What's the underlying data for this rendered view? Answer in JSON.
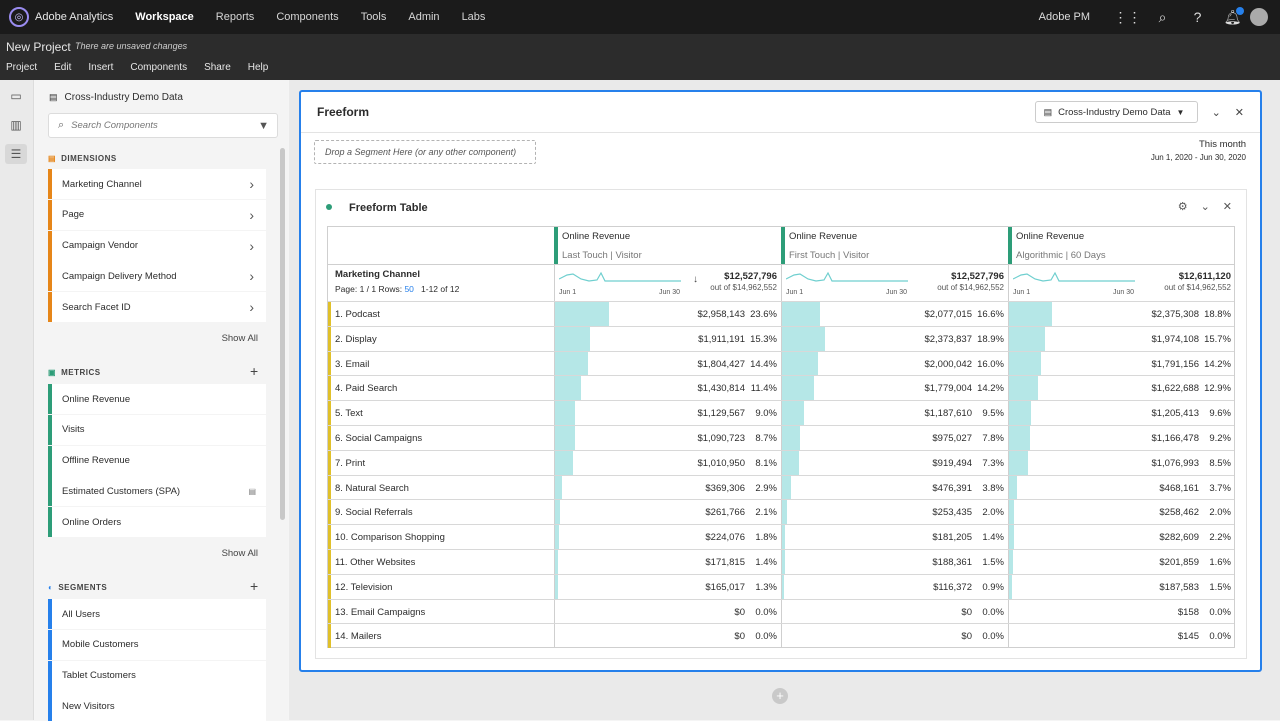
{
  "topbar": {
    "app_name": "Adobe Analytics",
    "nav": [
      "Workspace",
      "Reports",
      "Components",
      "Tools",
      "Admin",
      "Labs"
    ],
    "active_nav": "Workspace",
    "org": "Adobe PM",
    "icons": [
      "apps-grid-icon",
      "search-icon",
      "help-icon",
      "bell-icon",
      "avatar"
    ]
  },
  "project": {
    "title": "New Project",
    "status": "There are unsaved changes",
    "menu": [
      "Project",
      "Edit",
      "Insert",
      "Components",
      "Share",
      "Help"
    ]
  },
  "left_panel": {
    "report_suite": "Cross-Industry Demo Data",
    "search_placeholder": "Search Components",
    "dimensions_title": "DIMENSIONS",
    "dimensions": [
      "Marketing Channel",
      "Page",
      "Campaign Vendor",
      "Campaign Delivery Method",
      "Search Facet ID"
    ],
    "metrics_title": "METRICS",
    "metrics": [
      "Online Revenue",
      "Visits",
      "Offline Revenue",
      "Estimated Customers (SPA)",
      "Online Orders"
    ],
    "segments_title": "SEGMENTS",
    "segments": [
      "All Users",
      "Mobile Customers",
      "Tablet Customers",
      "New Visitors"
    ],
    "show_all": "Show All"
  },
  "freeform": {
    "title": "Freeform",
    "report_suite": "Cross-Industry Demo Data",
    "drop_zone": "Drop a Segment Here (or any other component)",
    "date_title": "This month",
    "date_range": "Jun 1, 2020 - Jun 30, 2020",
    "table_title": "Freeform Table",
    "dimension_header": "Marketing Channel",
    "pager_prefix": "Page: 1 / 1  Rows: ",
    "pager_rows": "50",
    "pager_suffix": "1-12 of 12",
    "columns": [
      {
        "metric": "Online Revenue",
        "attribution": "Last Touch | Visitor",
        "total": "$12,527,796",
        "out_of": "out of $14,962,552",
        "date_start": "Jun 1",
        "date_end": "Jun 30"
      },
      {
        "metric": "Online Revenue",
        "attribution": "First Touch | Visitor",
        "total": "$12,527,796",
        "out_of": "out of $14,962,552",
        "date_start": "Jun 1",
        "date_end": "Jun 30"
      },
      {
        "metric": "Online Revenue",
        "attribution": "Algorithmic | 60 Days",
        "total": "$12,611,120",
        "out_of": "out of $14,962,552",
        "date_start": "Jun 1",
        "date_end": "Jun 30"
      }
    ],
    "rows": [
      {
        "label": "1.  Podcast",
        "cells": [
          [
            "$2,958,143",
            "23.6%",
            0.236
          ],
          [
            "$2,077,015",
            "16.6%",
            0.166
          ],
          [
            "$2,375,308",
            "18.8%",
            0.188
          ]
        ]
      },
      {
        "label": "2.  Display",
        "cells": [
          [
            "$1,911,191",
            "15.3%",
            0.153
          ],
          [
            "$2,373,837",
            "18.9%",
            0.189
          ],
          [
            "$1,974,108",
            "15.7%",
            0.157
          ]
        ]
      },
      {
        "label": "3.  Email",
        "cells": [
          [
            "$1,804,427",
            "14.4%",
            0.144
          ],
          [
            "$2,000,042",
            "16.0%",
            0.16
          ],
          [
            "$1,791,156",
            "14.2%",
            0.142
          ]
        ]
      },
      {
        "label": "4.  Paid Search",
        "cells": [
          [
            "$1,430,814",
            "11.4%",
            0.114
          ],
          [
            "$1,779,004",
            "14.2%",
            0.142
          ],
          [
            "$1,622,688",
            "12.9%",
            0.129
          ]
        ]
      },
      {
        "label": "5.  Text",
        "cells": [
          [
            "$1,129,567",
            "9.0%",
            0.09
          ],
          [
            "$1,187,610",
            "9.5%",
            0.095
          ],
          [
            "$1,205,413",
            "9.6%",
            0.096
          ]
        ]
      },
      {
        "label": "6.  Social Campaigns",
        "cells": [
          [
            "$1,090,723",
            "8.7%",
            0.087
          ],
          [
            "$975,027",
            "7.8%",
            0.078
          ],
          [
            "$1,166,478",
            "9.2%",
            0.092
          ]
        ]
      },
      {
        "label": "7.  Print",
        "cells": [
          [
            "$1,010,950",
            "8.1%",
            0.081
          ],
          [
            "$919,494",
            "7.3%",
            0.073
          ],
          [
            "$1,076,993",
            "8.5%",
            0.085
          ]
        ]
      },
      {
        "label": "8.  Natural Search",
        "cells": [
          [
            "$369,306",
            "2.9%",
            0.029
          ],
          [
            "$476,391",
            "3.8%",
            0.038
          ],
          [
            "$468,161",
            "3.7%",
            0.037
          ]
        ]
      },
      {
        "label": "9.  Social Referrals",
        "cells": [
          [
            "$261,766",
            "2.1%",
            0.021
          ],
          [
            "$253,435",
            "2.0%",
            0.02
          ],
          [
            "$258,462",
            "2.0%",
            0.02
          ]
        ]
      },
      {
        "label": "10.  Comparison Shopping",
        "cells": [
          [
            "$224,076",
            "1.8%",
            0.018
          ],
          [
            "$181,205",
            "1.4%",
            0.014
          ],
          [
            "$282,609",
            "2.2%",
            0.022
          ]
        ]
      },
      {
        "label": "11.  Other Websites",
        "cells": [
          [
            "$171,815",
            "1.4%",
            0.014
          ],
          [
            "$188,361",
            "1.5%",
            0.015
          ],
          [
            "$201,859",
            "1.6%",
            0.016
          ]
        ]
      },
      {
        "label": "12.  Television",
        "cells": [
          [
            "$165,017",
            "1.3%",
            0.013
          ],
          [
            "$116,372",
            "0.9%",
            0.009
          ],
          [
            "$187,583",
            "1.5%",
            0.015
          ]
        ]
      },
      {
        "label": "13.  Email Campaigns",
        "cells": [
          [
            "$0",
            "0.0%",
            0
          ],
          [
            "$0",
            "0.0%",
            0
          ],
          [
            "$158",
            "0.0%",
            0
          ]
        ]
      },
      {
        "label": "14.  Mailers",
        "cells": [
          [
            "$0",
            "0.0%",
            0
          ],
          [
            "$0",
            "0.0%",
            0
          ],
          [
            "$145",
            "0.0%",
            0
          ]
        ]
      }
    ]
  },
  "colors": {
    "dimension": "#e68619",
    "metric": "#2d9d78",
    "segment": "#2680eb",
    "bar": "#a8e3e3",
    "row_marker": "#e0c02a"
  }
}
